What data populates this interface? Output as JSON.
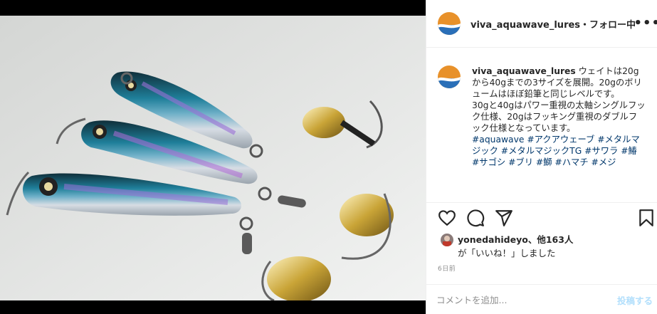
{
  "post": {
    "username": "viva_aquawave_lures",
    "follow_status": "・フォロー中",
    "more_label": "•••",
    "image_alt": "Three metal jig fishing lures with gold blade spinners and treble/double hooks"
  },
  "caption": {
    "username": "viva_aquawave_lures",
    "line1": "ウェイトは20gから40gまでの3サイズを展開。20gのボリュームはほぼ鉛筆と同じレベルです。",
    "line2": "30gと40gはパワー重視の太軸シングルフック仕様、20gはフッキング重視のダブルフック仕様となっています。",
    "hashtags": "#aquawave #アクアウェーブ #メタルマジック #メタルマジックTG #サワラ #鰆 #サゴシ #ブリ #鰤 #ハマチ #メジ"
  },
  "actions": {
    "like_icon": "heart-icon",
    "comment_icon": "comment-icon",
    "share_icon": "paper-plane-icon",
    "save_icon": "bookmark-icon"
  },
  "likes": {
    "user": "yonedahideyo",
    "others": "、他163人",
    "line2": "が「いいね！」しました"
  },
  "timestamp": "6日前",
  "comment_box": {
    "placeholder": "コメントを追加...",
    "post_label": "投稿する"
  },
  "colors": {
    "link_blue": "#00376b",
    "post_button_disabled": "#b2dffc",
    "border": "#efefef",
    "muted": "#8e8e8e"
  }
}
